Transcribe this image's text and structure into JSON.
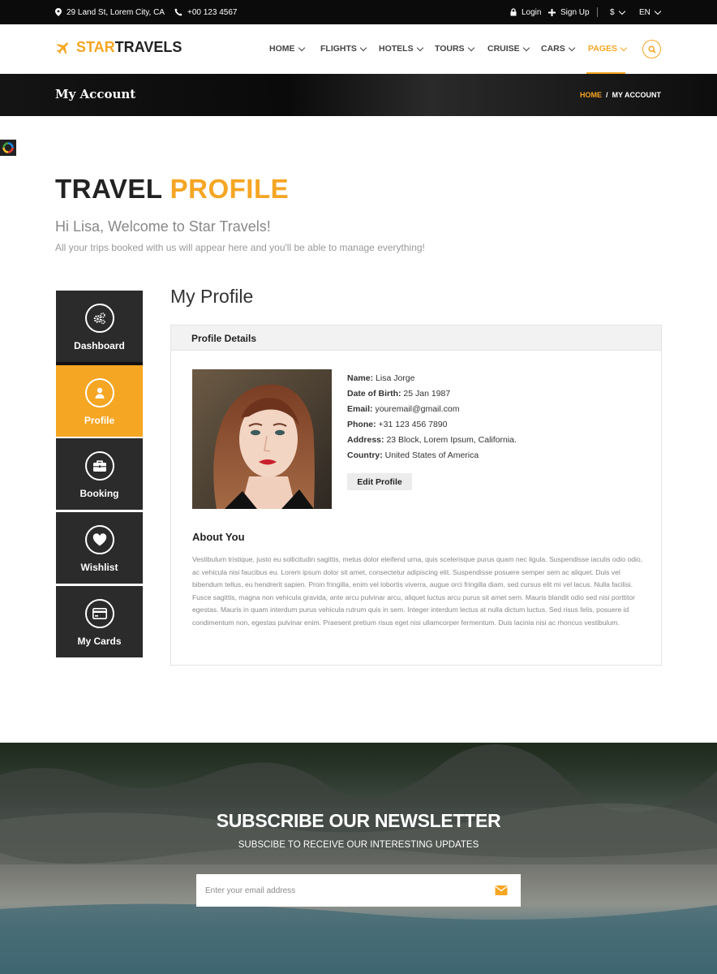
{
  "topbar": {
    "address": "29 Land St, Lorem City, CA",
    "phone": "+00 123 4567",
    "login": "Login",
    "signup": "Sign Up",
    "currency": "$",
    "language": "EN"
  },
  "header": {
    "logo_part1": "STAR",
    "logo_part2": "TRAVELS",
    "nav": [
      "HOME",
      "FLIGHTS",
      "HOTELS",
      "TOURS",
      "CRUISE",
      "CARS",
      "PAGES"
    ],
    "active_nav": "PAGES"
  },
  "page_band": {
    "title": "My Account",
    "breadcrumb_home": "HOME",
    "breadcrumb_sep": "/",
    "breadcrumb_current": "MY ACCOUNT"
  },
  "intro": {
    "title_part1": "TRAVEL",
    "title_part2": "PROFILE",
    "welcome": "Hi Lisa, Welcome to Star Travels!",
    "subtitle": "All your trips booked with us will appear here and you'll be able to manage everything!"
  },
  "sidebar": {
    "items": [
      {
        "label": "Dashboard",
        "icon": "gears-icon"
      },
      {
        "label": "Profile",
        "icon": "user-icon"
      },
      {
        "label": "Booking",
        "icon": "briefcase-icon"
      },
      {
        "label": "Wishlist",
        "icon": "heart-icon"
      },
      {
        "label": "My Cards",
        "icon": "credit-card-icon"
      }
    ],
    "active": "Profile"
  },
  "profile": {
    "heading": "My Profile",
    "panel_title": "Profile Details",
    "fields": [
      {
        "label": "Name:",
        "value": "Lisa Jorge"
      },
      {
        "label": "Date of Birth:",
        "value": "25 Jan 1987"
      },
      {
        "label": "Email:",
        "value": "youremail@gmail.com"
      },
      {
        "label": "Phone:",
        "value": "+31 123 456 7890"
      },
      {
        "label": "Address:",
        "value": "23 Block, Lorem Ipsum, California."
      },
      {
        "label": "Country:",
        "value": "United States of America"
      }
    ],
    "edit_button": "Edit Profile",
    "about_title": "About You",
    "about_text": "Vestibulum tristique, justo eu sollicitudin sagittis, metus dolor eleifend urna, quis scelerisque purus quam nec ligula. Suspendisse iaculis odio odio, ac vehicula nisi faucibus eu. Lorem ipsum dolor sit amet, consectetur adipiscing elit. Suspendisse posuere semper sem ac aliquet. Duis vel bibendum tellus, eu hendrerit sapien. Proin fringilla, enim vel lobortis viverra, augue orci fringilla diam, sed cursus elit mi vel lacus. Nulla facilisi. Fusce sagittis, magna non vehicula gravida, ante arcu pulvinar arcu, aliquet luctus arcu purus sit amet sem. Mauris blandit odio sed nisi porttitor egestas. Mauris in quam interdum purus vehicula rutrum quis in sem. Integer interdum lectus at nulla dictum luctus. Sed risus felis, posuere id condimentum non, egestas pulvinar enim. Praesent pretium risus eget nisi ullamcorper fermentum. Duis lacinia nisi ac rhoncus vestibulum."
  },
  "newsletter": {
    "title": "SUBSCRIBE OUR NEWSLETTER",
    "subtitle": "SUBSCIBE TO RECEIVE OUR INTERESTING UPDATES",
    "placeholder": "Enter your email address"
  },
  "colors": {
    "accent": "#f5a623",
    "dark": "#2b2b2b",
    "topbar": "#0b0b0b"
  }
}
